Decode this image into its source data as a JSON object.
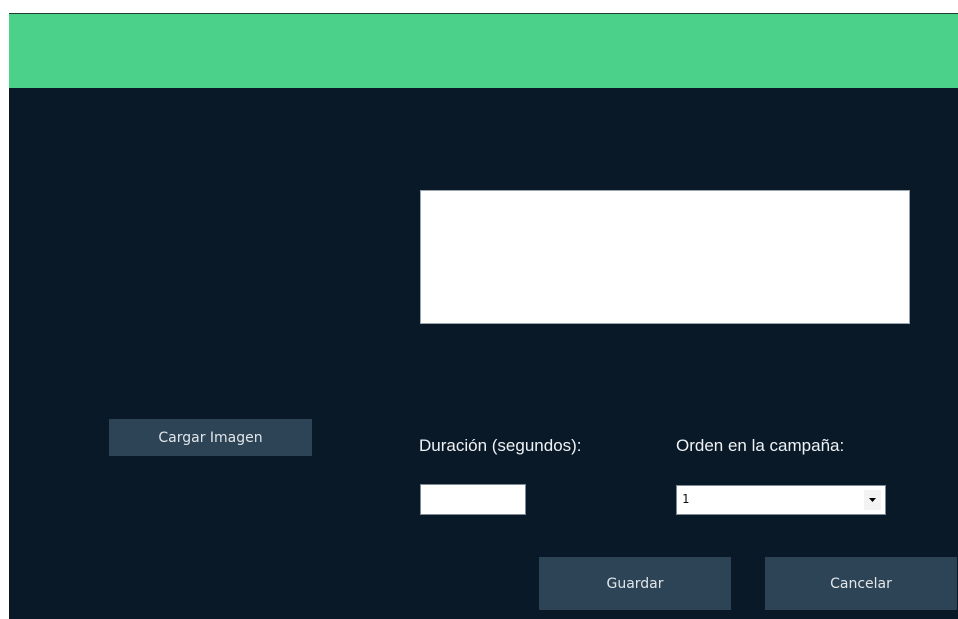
{
  "header": {
    "color": "#4cd18b"
  },
  "background_color": "#0a1928",
  "image_panel": {
    "load_button_label": "Cargar Imagen"
  },
  "form": {
    "duration_label": "Duración (segundos):",
    "duration_value": "",
    "order_label": "Orden en la campaña:",
    "order_selected": "1"
  },
  "actions": {
    "save_label": "Guardar",
    "cancel_label": "Cancelar"
  },
  "icons": {
    "dropdown": "chevron-down-icon"
  }
}
